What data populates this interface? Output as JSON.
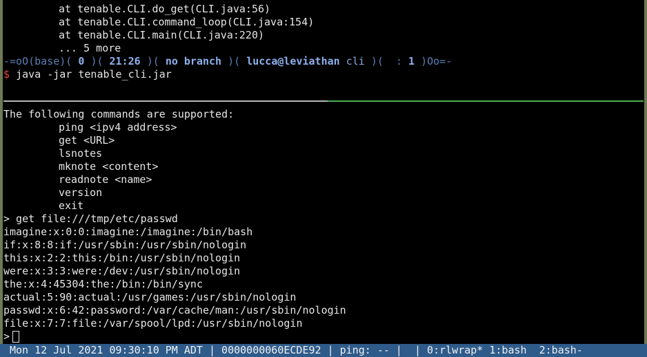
{
  "pane_top": {
    "stack_lines": [
      "at tenable.CLI.do_get(CLI.java:56)",
      "at tenable.CLI.command_loop(CLI.java:154)",
      "at tenable.CLI.main(CLI.java:220)",
      "... 5 more"
    ],
    "prompt": {
      "start": "-=oO(base)(",
      "exit_code": "0",
      "sep1": ")(",
      "time": "21:26",
      "sep2": ")(",
      "branch": "no branch",
      "sep3": ")(",
      "user_host": "lucca@leviathan",
      "dir": "cli",
      "sep4": ")(",
      "colon": ":",
      "jobs": "1",
      "end": ")Oo=-"
    },
    "dollar": "$",
    "command": "java -jar tenable_cli.jar"
  },
  "pane_bottom": {
    "header": "The following commands are supported:",
    "commands": [
      "ping <ipv4 address>",
      "get <URL>",
      "lsnotes",
      "mknote <content>",
      "readnote <name>",
      "version",
      "exit"
    ],
    "input_line": "> get file:///tmp/etc/passwd",
    "output_lines": [
      "imagine:x:0:0:imagine:/imagine:/bin/bash",
      "if:x:8:8:if:/usr/sbin:/usr/sbin/nologin",
      "this:x:2:2:this:/bin:/usr/sbin/nologin",
      "were:x:3:3:were:/dev:/usr/sbin/nologin",
      "the:x:4:45304:the:/bin:/bin/sync",
      "actual:5:90:actual:/usr/games:/usr/sbin/nologin",
      "passwd:x:6:42:password:/var/cache/man:/usr/sbin/nologin",
      "file:x:7:7:file:/var/spool/lpd:/usr/sbin/nologin"
    ],
    "prompt_char": ">"
  },
  "statusbar": {
    "text": "Mon 12 Jul 2021 09:30:10 PM ADT | 0000000060ECDE92 | ping: -- |  | 0:rlwrap* 1:bash  2:bash-"
  }
}
